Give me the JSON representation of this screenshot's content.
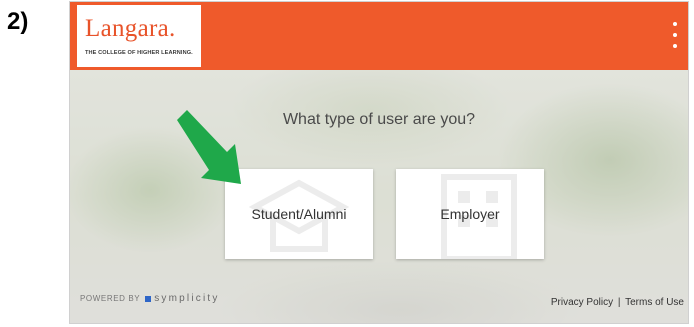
{
  "step_label": "2)",
  "header": {
    "logo_name": "Langara.",
    "logo_tagline": "THE COLLEGE OF HIGHER LEARNING.",
    "menu_icon": "kebab-menu-icon",
    "bar_color": "#ef5a2b"
  },
  "main": {
    "question": "What type of user are you?",
    "options": [
      {
        "label": "Student/Alumni",
        "icon": "graduation-cap-icon"
      },
      {
        "label": "Employer",
        "icon": "building-icon"
      }
    ]
  },
  "annotation": {
    "arrow_color": "#1fa84a",
    "icon": "arrow-pointer-icon"
  },
  "footer": {
    "powered_by": "POWERED BY",
    "brand": "symplicity",
    "privacy_link": "Privacy Policy",
    "separator": "|",
    "terms_link": "Terms of Use"
  }
}
